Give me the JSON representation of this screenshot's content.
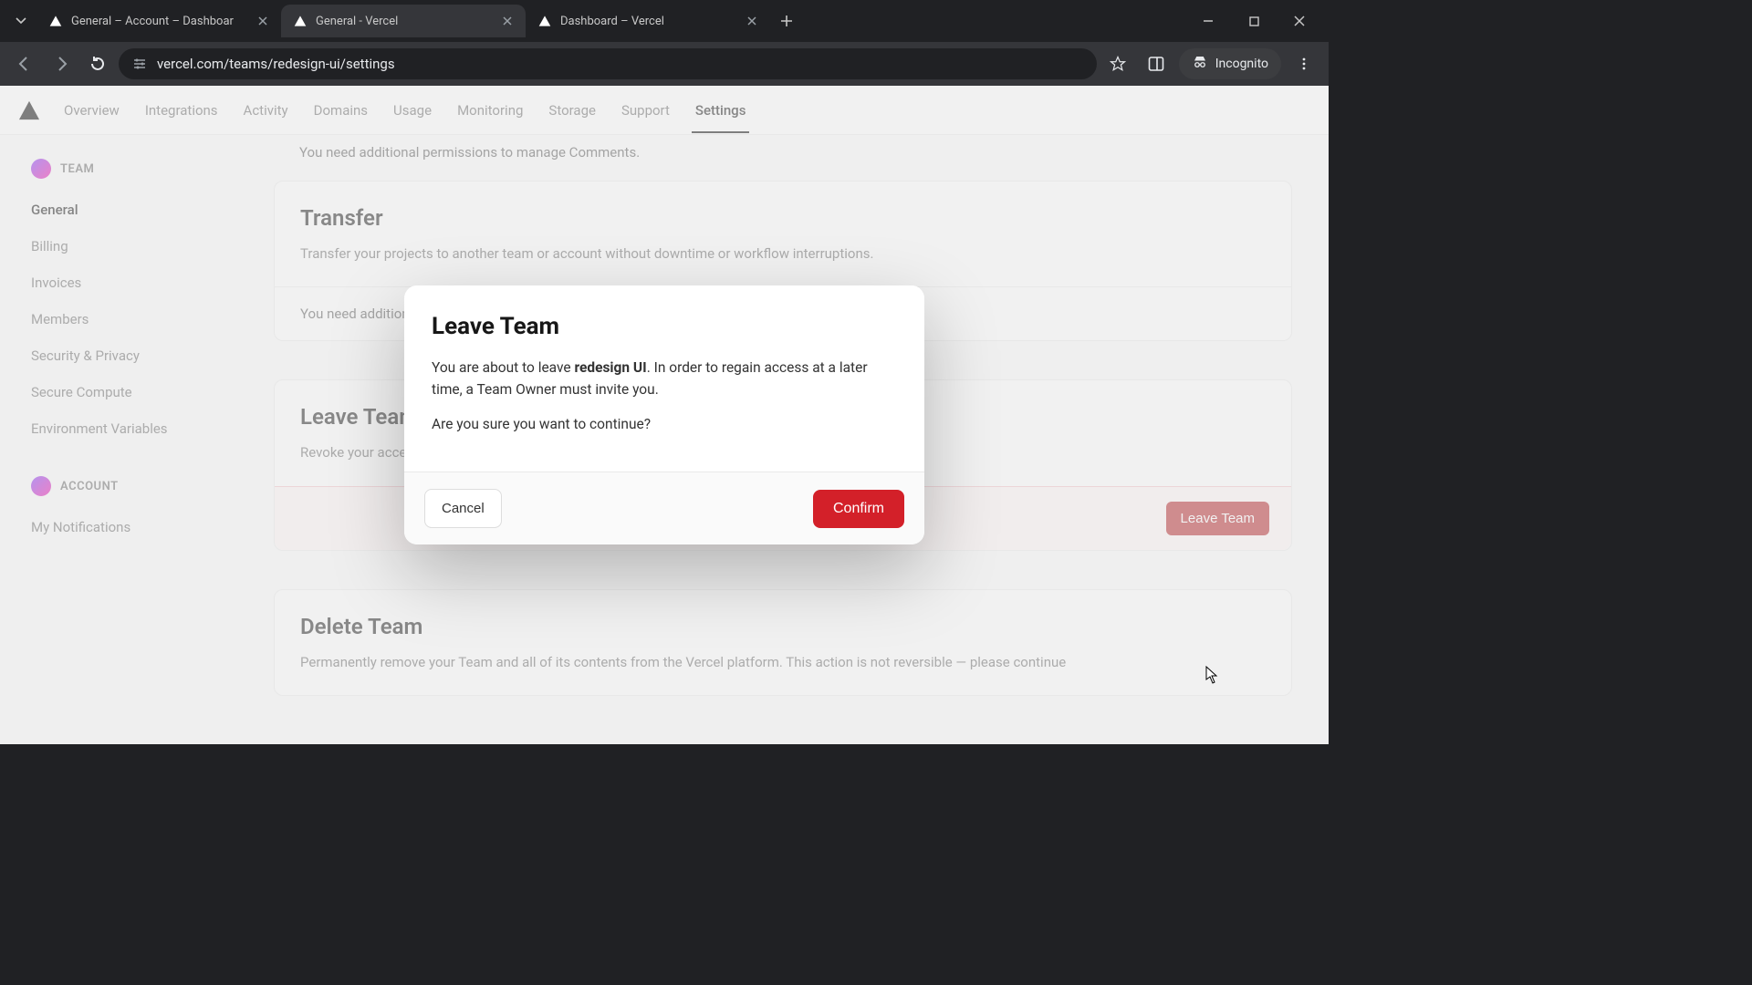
{
  "browser": {
    "tabs": [
      {
        "title": "General – Account – Dashboar",
        "active": false
      },
      {
        "title": "General - Vercel",
        "active": true
      },
      {
        "title": "Dashboard – Vercel",
        "active": false
      }
    ],
    "url": "vercel.com/teams/redesign-ui/settings",
    "incognito_label": "Incognito"
  },
  "topnav": {
    "items": [
      "Overview",
      "Integrations",
      "Activity",
      "Domains",
      "Usage",
      "Monitoring",
      "Storage",
      "Support",
      "Settings"
    ],
    "active": "Settings"
  },
  "sidebar": {
    "team_label": "TEAM",
    "team_links": [
      "General",
      "Billing",
      "Invoices",
      "Members",
      "Security & Privacy",
      "Secure Compute",
      "Environment Variables"
    ],
    "team_active": "General",
    "account_label": "ACCOUNT",
    "account_links": [
      "My Notifications"
    ]
  },
  "hint_comments": "You need additional permissions to manage Comments.",
  "card_transfer": {
    "title": "Transfer",
    "desc": "Transfer your projects to another team or account without downtime or workflow interruptions.",
    "perm_line": "You need additional permissions to transfer projects."
  },
  "card_leave": {
    "title": "Leave Team",
    "desc": "Revoke your access to this Team. Any resources you've added to this Team will remain.",
    "button": "Leave Team"
  },
  "card_delete": {
    "title": "Delete Team",
    "desc": "Permanently remove your Team and all of its contents from the Vercel platform. This action is not reversible — please continue"
  },
  "modal": {
    "title": "Leave Team",
    "p1_pre": "You are about to leave ",
    "p1_team": "redesign UI",
    "p1_post": ". In order to regain access at a later time, a Team Owner must invite you.",
    "p2": "Are you sure you want to continue?",
    "cancel": "Cancel",
    "confirm": "Confirm"
  }
}
